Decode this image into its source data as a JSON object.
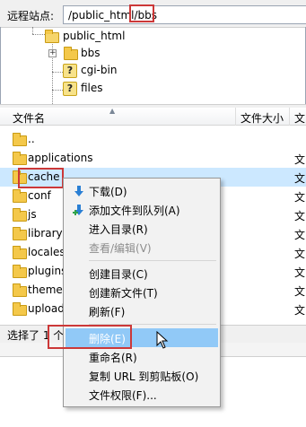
{
  "remote_site": {
    "label": "远程站点:",
    "path_prefix": "/public_html/",
    "path_highlight": "bbs"
  },
  "tree": {
    "items": [
      {
        "label": "public_html",
        "icon": "folder-open-icon"
      },
      {
        "label": "bbs",
        "icon": "folder-icon",
        "expander": "+"
      },
      {
        "label": "cgi-bin",
        "icon": "unknown-folder-icon"
      },
      {
        "label": "files",
        "icon": "unknown-folder-icon"
      }
    ]
  },
  "list": {
    "columns": {
      "name": "文件名",
      "size": "文件大小",
      "type": "文"
    },
    "rows": [
      {
        "name": "..",
        "type": ""
      },
      {
        "name": "applications",
        "type": "文"
      },
      {
        "name": "cache",
        "type": "文",
        "selected": true
      },
      {
        "name": "conf",
        "type": "文"
      },
      {
        "name": "js",
        "type": "文"
      },
      {
        "name": "library",
        "type": "文"
      },
      {
        "name": "locales",
        "type": "文"
      },
      {
        "name": "plugins",
        "type": "文"
      },
      {
        "name": "themes",
        "type": "文"
      },
      {
        "name": "uploads",
        "type": "文"
      }
    ]
  },
  "status": {
    "text": "选择了 1 个"
  },
  "context_menu": {
    "items": [
      {
        "label": "下载(D)",
        "icon": "download-icon",
        "disabled": false
      },
      {
        "label": "添加文件到队列(A)",
        "icon": "add-to-queue-icon",
        "disabled": false
      },
      {
        "label": "进入目录(R)",
        "disabled": false
      },
      {
        "label": "查看/编辑(V)",
        "disabled": true
      },
      {
        "label": "创建目录(C)",
        "disabled": false
      },
      {
        "label": "创建新文件(T)",
        "disabled": false
      },
      {
        "label": "刷新(F)",
        "disabled": false
      },
      {
        "label": "删除(E)",
        "disabled": false,
        "hover": true
      },
      {
        "label": "重命名(R)",
        "disabled": false
      },
      {
        "label": "复制 URL 到剪贴板(O)",
        "disabled": false
      },
      {
        "label": "文件权限(F)...",
        "disabled": false
      }
    ]
  },
  "colors": {
    "selection": "#cce8ff",
    "menu_hover": "#91c9f7",
    "highlight_box": "#cc3838",
    "folder": "#f4c84a"
  }
}
